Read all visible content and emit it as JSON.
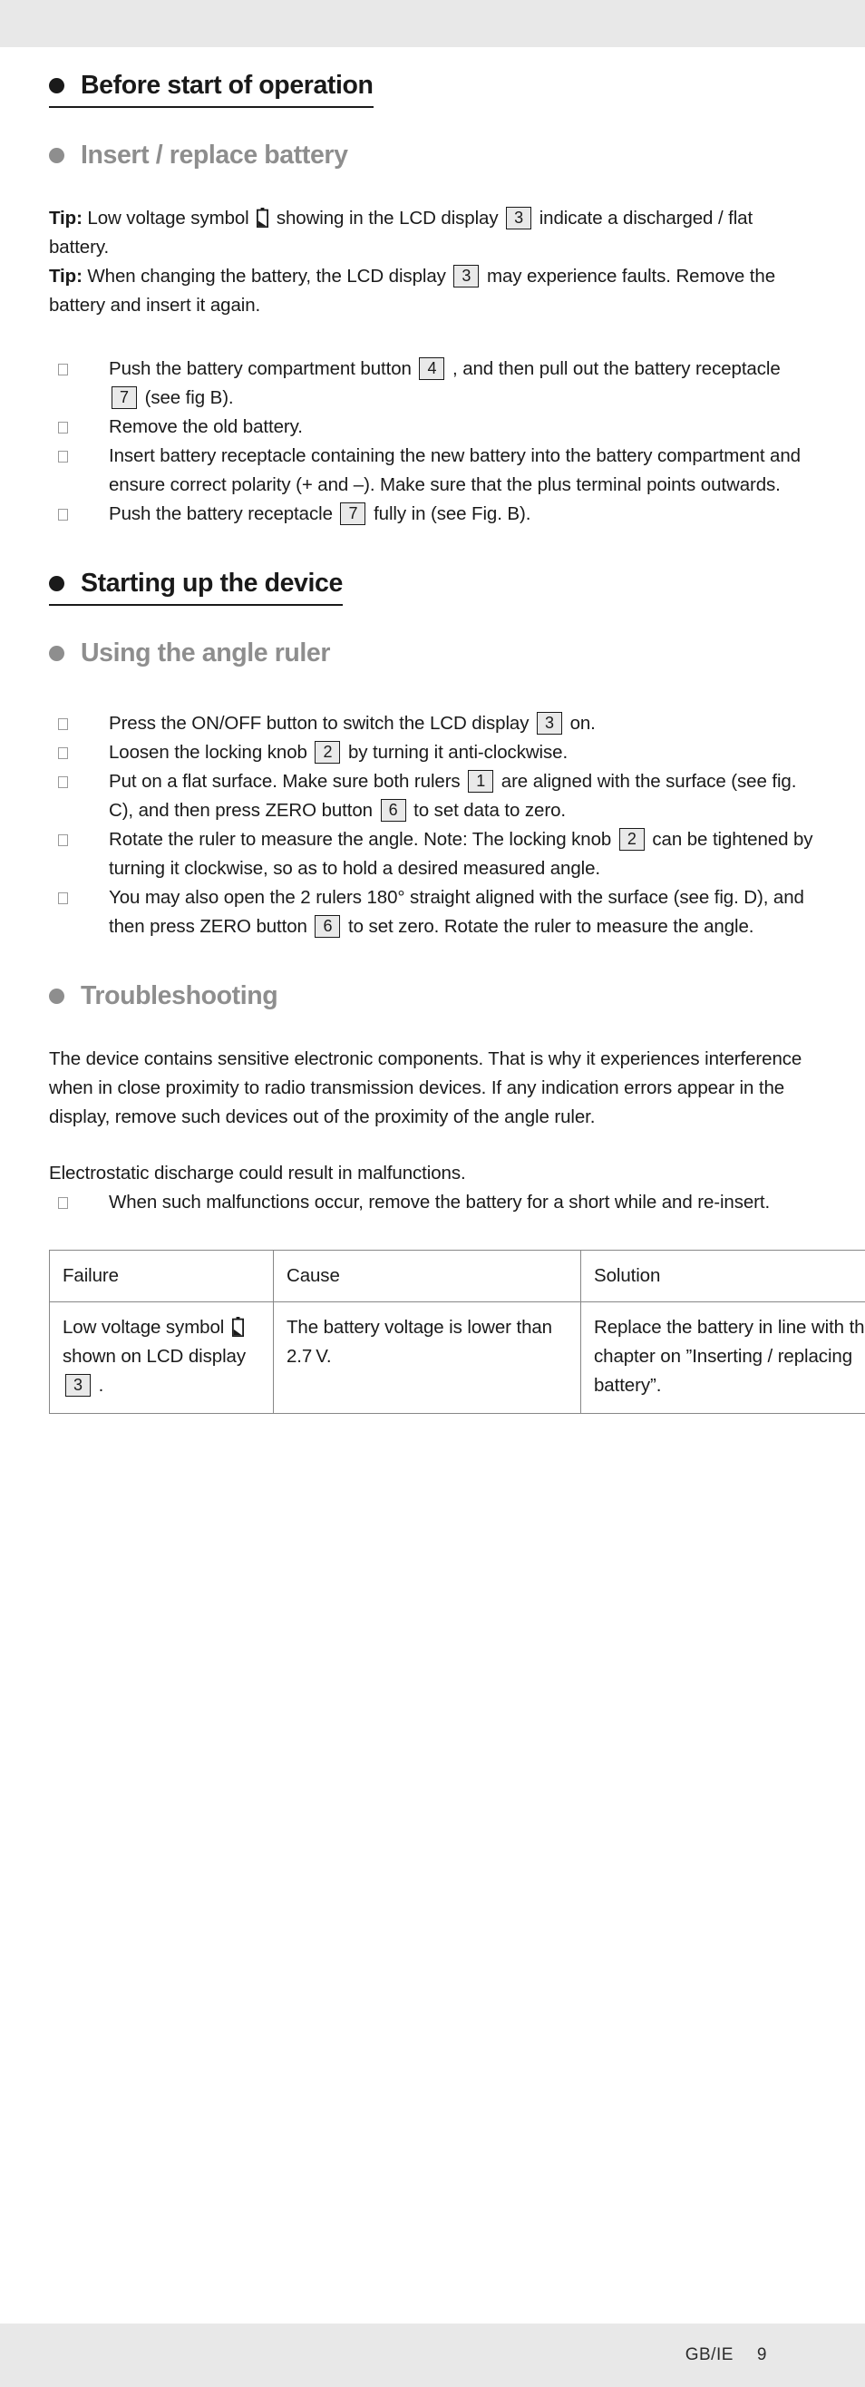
{
  "page": {
    "footer_locale": "GB/IE",
    "footer_page_number": "9"
  },
  "sections": {
    "before_start": {
      "heading": "Before start of operation",
      "sub_heading": "Insert / replace battery",
      "tip1": {
        "label": "Tip:",
        "text_before_symbol": " Low voltage symbol ",
        "symbol": "low-battery-icon",
        "text_after_symbol": " showing in the LCD display ",
        "ref": "3",
        "text_end": " indicate a discharged / flat battery."
      },
      "tip2": {
        "label": "Tip:",
        "text_before_ref": " When changing the battery, the LCD display ",
        "ref": "3",
        "text_after_ref": " may experience faults. Remove the battery and insert it again."
      },
      "steps": [
        {
          "parts": [
            {
              "t": "text",
              "v": "Push the battery compartment button "
            },
            {
              "t": "ref",
              "v": "4"
            },
            {
              "t": "text",
              "v": " , and then pull out the battery receptacle "
            },
            {
              "t": "ref",
              "v": "7"
            },
            {
              "t": "text",
              "v": " (see fig B)."
            }
          ]
        },
        {
          "parts": [
            {
              "t": "text",
              "v": "Remove the old battery."
            }
          ]
        },
        {
          "parts": [
            {
              "t": "text",
              "v": "Insert battery receptacle containing the new battery into the battery compartment and ensure correct polarity (+ and –). Make sure that  the plus terminal points outwards."
            }
          ]
        },
        {
          "parts": [
            {
              "t": "text",
              "v": "Push the battery receptacle "
            },
            {
              "t": "ref",
              "v": "7"
            },
            {
              "t": "text",
              "v": " fully in (see Fig. B)."
            }
          ]
        }
      ]
    },
    "starting_up": {
      "heading": "Starting up the device",
      "sub_heading": "Using the angle ruler",
      "steps": [
        {
          "parts": [
            {
              "t": "text",
              "v": "Press the ON/OFF button to switch the LCD display "
            },
            {
              "t": "ref",
              "v": "3"
            },
            {
              "t": "text",
              "v": " on."
            }
          ]
        },
        {
          "parts": [
            {
              "t": "text",
              "v": "Loosen the locking knob "
            },
            {
              "t": "ref",
              "v": "2"
            },
            {
              "t": "text",
              "v": " by turning it anti-clockwise."
            }
          ]
        },
        {
          "parts": [
            {
              "t": "text",
              "v": "Put on a flat surface. Make sure both rulers "
            },
            {
              "t": "ref",
              "v": "1"
            },
            {
              "t": "text",
              "v": " are aligned with the surface (see fig. C), and then press ZERO button "
            },
            {
              "t": "ref",
              "v": "6"
            },
            {
              "t": "text",
              "v": " to set data to zero."
            }
          ]
        },
        {
          "parts": [
            {
              "t": "text",
              "v": "Rotate the ruler to measure the angle. Note: The locking knob "
            },
            {
              "t": "ref",
              "v": "2"
            },
            {
              "t": "text",
              "v": " can be tightened by turning it clockwise, so as to hold a desired measured angle."
            }
          ]
        },
        {
          "parts": [
            {
              "t": "text",
              "v": "You may also open the 2 rulers 180° straight aligned with the surface (see fig. D), and then press ZERO button "
            },
            {
              "t": "ref",
              "v": "6"
            },
            {
              "t": "text",
              "v": " to set zero. Rotate the ruler to measure the angle."
            }
          ]
        }
      ]
    },
    "troubleshooting": {
      "heading": "Troubleshooting",
      "paragraph1": "The device contains sensitive electronic components. That is why it experiences interference when in close proximity to radio transmission devices. If any indication errors appear in the display, remove such devices out of the proximity of the angle ruler.",
      "paragraph2": "Electrostatic discharge could result in malfunctions.",
      "steps": [
        {
          "parts": [
            {
              "t": "text",
              "v": "When such malfunctions occur, remove the battery for a short while and re-insert."
            }
          ]
        }
      ],
      "table": {
        "headers": [
          "Failure",
          "Cause",
          "Solution"
        ],
        "rows": [
          {
            "failure_parts": [
              {
                "t": "text",
                "v": "Low voltage symbol "
              },
              {
                "t": "batt",
                "v": "low-battery-icon"
              },
              {
                "t": "text",
                "v": " shown on LCD display "
              },
              {
                "t": "ref",
                "v": "3"
              },
              {
                "t": "text",
                "v": " ."
              }
            ],
            "cause": "The battery voltage is lower than 2.7 V.",
            "solution": "Replace the battery in line with the chapter on ”Inserting / replacing battery”."
          }
        ]
      }
    }
  },
  "colors": {
    "heading_black": "#1a1a1a",
    "heading_gray": "#8e8e8e",
    "ref_chip_bg": "#e9e9e9",
    "band_gray": "#e8e8e8",
    "table_border": "#878787"
  }
}
